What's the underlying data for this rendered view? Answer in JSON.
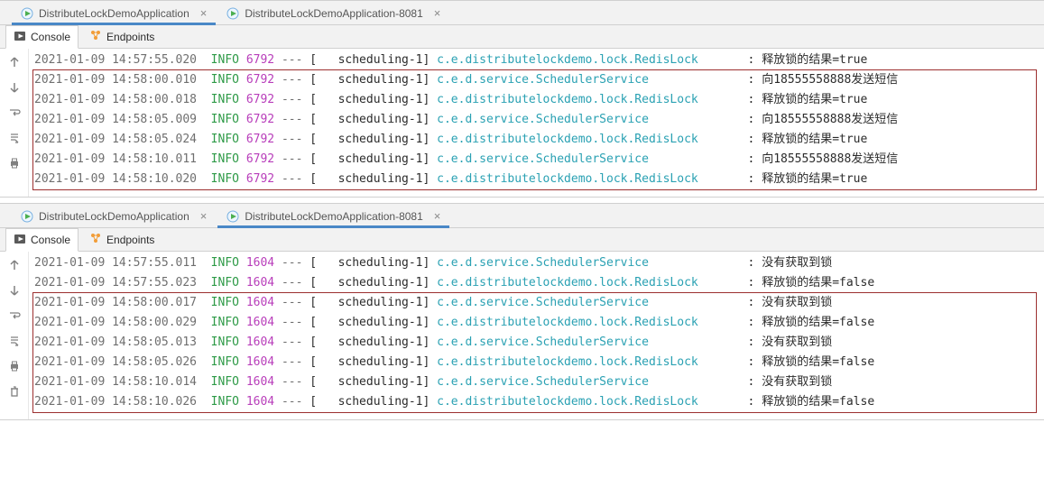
{
  "panes": [
    {
      "id": "top",
      "tabs": [
        {
          "label": "DistributeLockDemoApplication",
          "closable": true,
          "active": true
        },
        {
          "label": "DistributeLockDemoApplication-8081",
          "closable": true,
          "active": false
        }
      ],
      "subtabs": {
        "console": "Console",
        "endpoints": "Endpoints",
        "active": "console"
      },
      "highlight": {
        "from": 1,
        "to": 6
      },
      "log": [
        {
          "ts": "2021-01-09 14:57:55.020",
          "lvl": "INFO",
          "pid": "6792",
          "dash": "---",
          "thr": "scheduling-1",
          "cls": "c.e.distributelockdemo.lock.RedisLock",
          "msg": "释放锁的结果=true"
        },
        {
          "ts": "2021-01-09 14:58:00.010",
          "lvl": "INFO",
          "pid": "6792",
          "dash": "---",
          "thr": "scheduling-1",
          "cls": "c.e.d.service.SchedulerService",
          "msg": "向18555558888发送短信"
        },
        {
          "ts": "2021-01-09 14:58:00.018",
          "lvl": "INFO",
          "pid": "6792",
          "dash": "---",
          "thr": "scheduling-1",
          "cls": "c.e.distributelockdemo.lock.RedisLock",
          "msg": "释放锁的结果=true"
        },
        {
          "ts": "2021-01-09 14:58:05.009",
          "lvl": "INFO",
          "pid": "6792",
          "dash": "---",
          "thr": "scheduling-1",
          "cls": "c.e.d.service.SchedulerService",
          "msg": "向18555558888发送短信"
        },
        {
          "ts": "2021-01-09 14:58:05.024",
          "lvl": "INFO",
          "pid": "6792",
          "dash": "---",
          "thr": "scheduling-1",
          "cls": "c.e.distributelockdemo.lock.RedisLock",
          "msg": "释放锁的结果=true"
        },
        {
          "ts": "2021-01-09 14:58:10.011",
          "lvl": "INFO",
          "pid": "6792",
          "dash": "---",
          "thr": "scheduling-1",
          "cls": "c.e.d.service.SchedulerService",
          "msg": "向18555558888发送短信"
        },
        {
          "ts": "2021-01-09 14:58:10.020",
          "lvl": "INFO",
          "pid": "6792",
          "dash": "---",
          "thr": "scheduling-1",
          "cls": "c.e.distributelockdemo.lock.RedisLock",
          "msg": "释放锁的结果=true"
        }
      ]
    },
    {
      "id": "bottom",
      "tabs": [
        {
          "label": "DistributeLockDemoApplication",
          "closable": true,
          "active": false
        },
        {
          "label": "DistributeLockDemoApplication-8081",
          "closable": true,
          "active": true
        }
      ],
      "subtabs": {
        "console": "Console",
        "endpoints": "Endpoints",
        "active": "console"
      },
      "highlight": {
        "from": 2,
        "to": 7
      },
      "log": [
        {
          "ts": "2021-01-09 14:57:55.011",
          "lvl": "INFO",
          "pid": "1604",
          "dash": "---",
          "thr": "scheduling-1",
          "cls": "c.e.d.service.SchedulerService",
          "msg": "没有获取到锁"
        },
        {
          "ts": "2021-01-09 14:57:55.023",
          "lvl": "INFO",
          "pid": "1604",
          "dash": "---",
          "thr": "scheduling-1",
          "cls": "c.e.distributelockdemo.lock.RedisLock",
          "msg": "释放锁的结果=false"
        },
        {
          "ts": "2021-01-09 14:58:00.017",
          "lvl": "INFO",
          "pid": "1604",
          "dash": "---",
          "thr": "scheduling-1",
          "cls": "c.e.d.service.SchedulerService",
          "msg": "没有获取到锁"
        },
        {
          "ts": "2021-01-09 14:58:00.029",
          "lvl": "INFO",
          "pid": "1604",
          "dash": "---",
          "thr": "scheduling-1",
          "cls": "c.e.distributelockdemo.lock.RedisLock",
          "msg": "释放锁的结果=false"
        },
        {
          "ts": "2021-01-09 14:58:05.013",
          "lvl": "INFO",
          "pid": "1604",
          "dash": "---",
          "thr": "scheduling-1",
          "cls": "c.e.d.service.SchedulerService",
          "msg": "没有获取到锁"
        },
        {
          "ts": "2021-01-09 14:58:05.026",
          "lvl": "INFO",
          "pid": "1604",
          "dash": "---",
          "thr": "scheduling-1",
          "cls": "c.e.distributelockdemo.lock.RedisLock",
          "msg": "释放锁的结果=false"
        },
        {
          "ts": "2021-01-09 14:58:10.014",
          "lvl": "INFO",
          "pid": "1604",
          "dash": "---",
          "thr": "scheduling-1",
          "cls": "c.e.d.service.SchedulerService",
          "msg": "没有获取到锁"
        },
        {
          "ts": "2021-01-09 14:58:10.026",
          "lvl": "INFO",
          "pid": "1604",
          "dash": "---",
          "thr": "scheduling-1",
          "cls": "c.e.distributelockdemo.lock.RedisLock",
          "msg": "释放锁的结果=false"
        }
      ]
    }
  ],
  "column_widths": {
    "cls": 43
  }
}
